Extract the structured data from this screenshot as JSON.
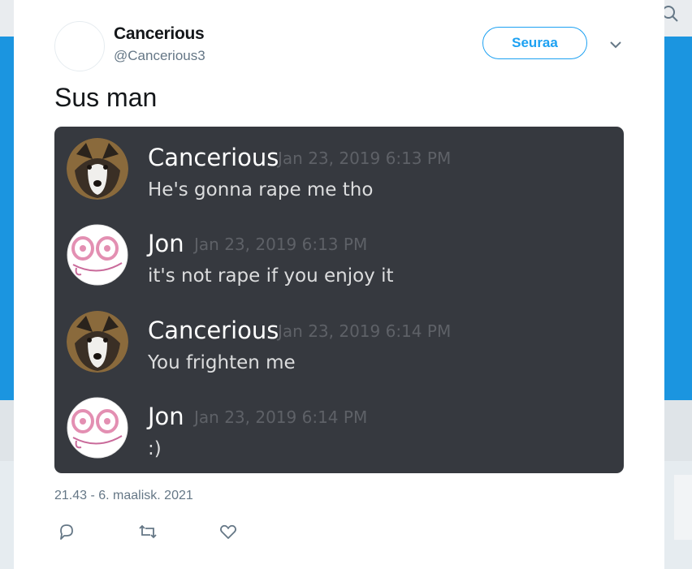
{
  "tweet": {
    "author_name": "Cancerious",
    "author_handle": "@Cancerious3",
    "follow_label": "Seuraa",
    "text": "Sus man",
    "timestamp": "21.43 - 6. maalisk. 2021"
  },
  "discord_messages": [
    {
      "author": "Cancerious",
      "time": "Jan 23, 2019 6:13 PM",
      "text": "He's gonna rape me tho",
      "avatar": "husky-avatar"
    },
    {
      "author": "Jon",
      "time": "Jan 23, 2019 6:13 PM",
      "text": "it's not rape if you enjoy it",
      "avatar": "cartoon-face-avatar"
    },
    {
      "author": "Cancerious",
      "time": "Jan 23, 2019 6:14 PM",
      "text": "You frighten me",
      "avatar": "husky-avatar"
    },
    {
      "author": "Jon",
      "time": "Jan 23, 2019 6:14 PM",
      "text": ":)",
      "avatar": "cartoon-face-avatar"
    }
  ],
  "icons": {
    "search": "search-icon",
    "more": "chevron-down-icon",
    "reply": "reply-icon",
    "retweet": "retweet-icon",
    "like": "heart-icon"
  },
  "colors": {
    "accent": "#1da1f2",
    "background_blue": "#1b95e0",
    "discord_bg": "#36393f"
  }
}
